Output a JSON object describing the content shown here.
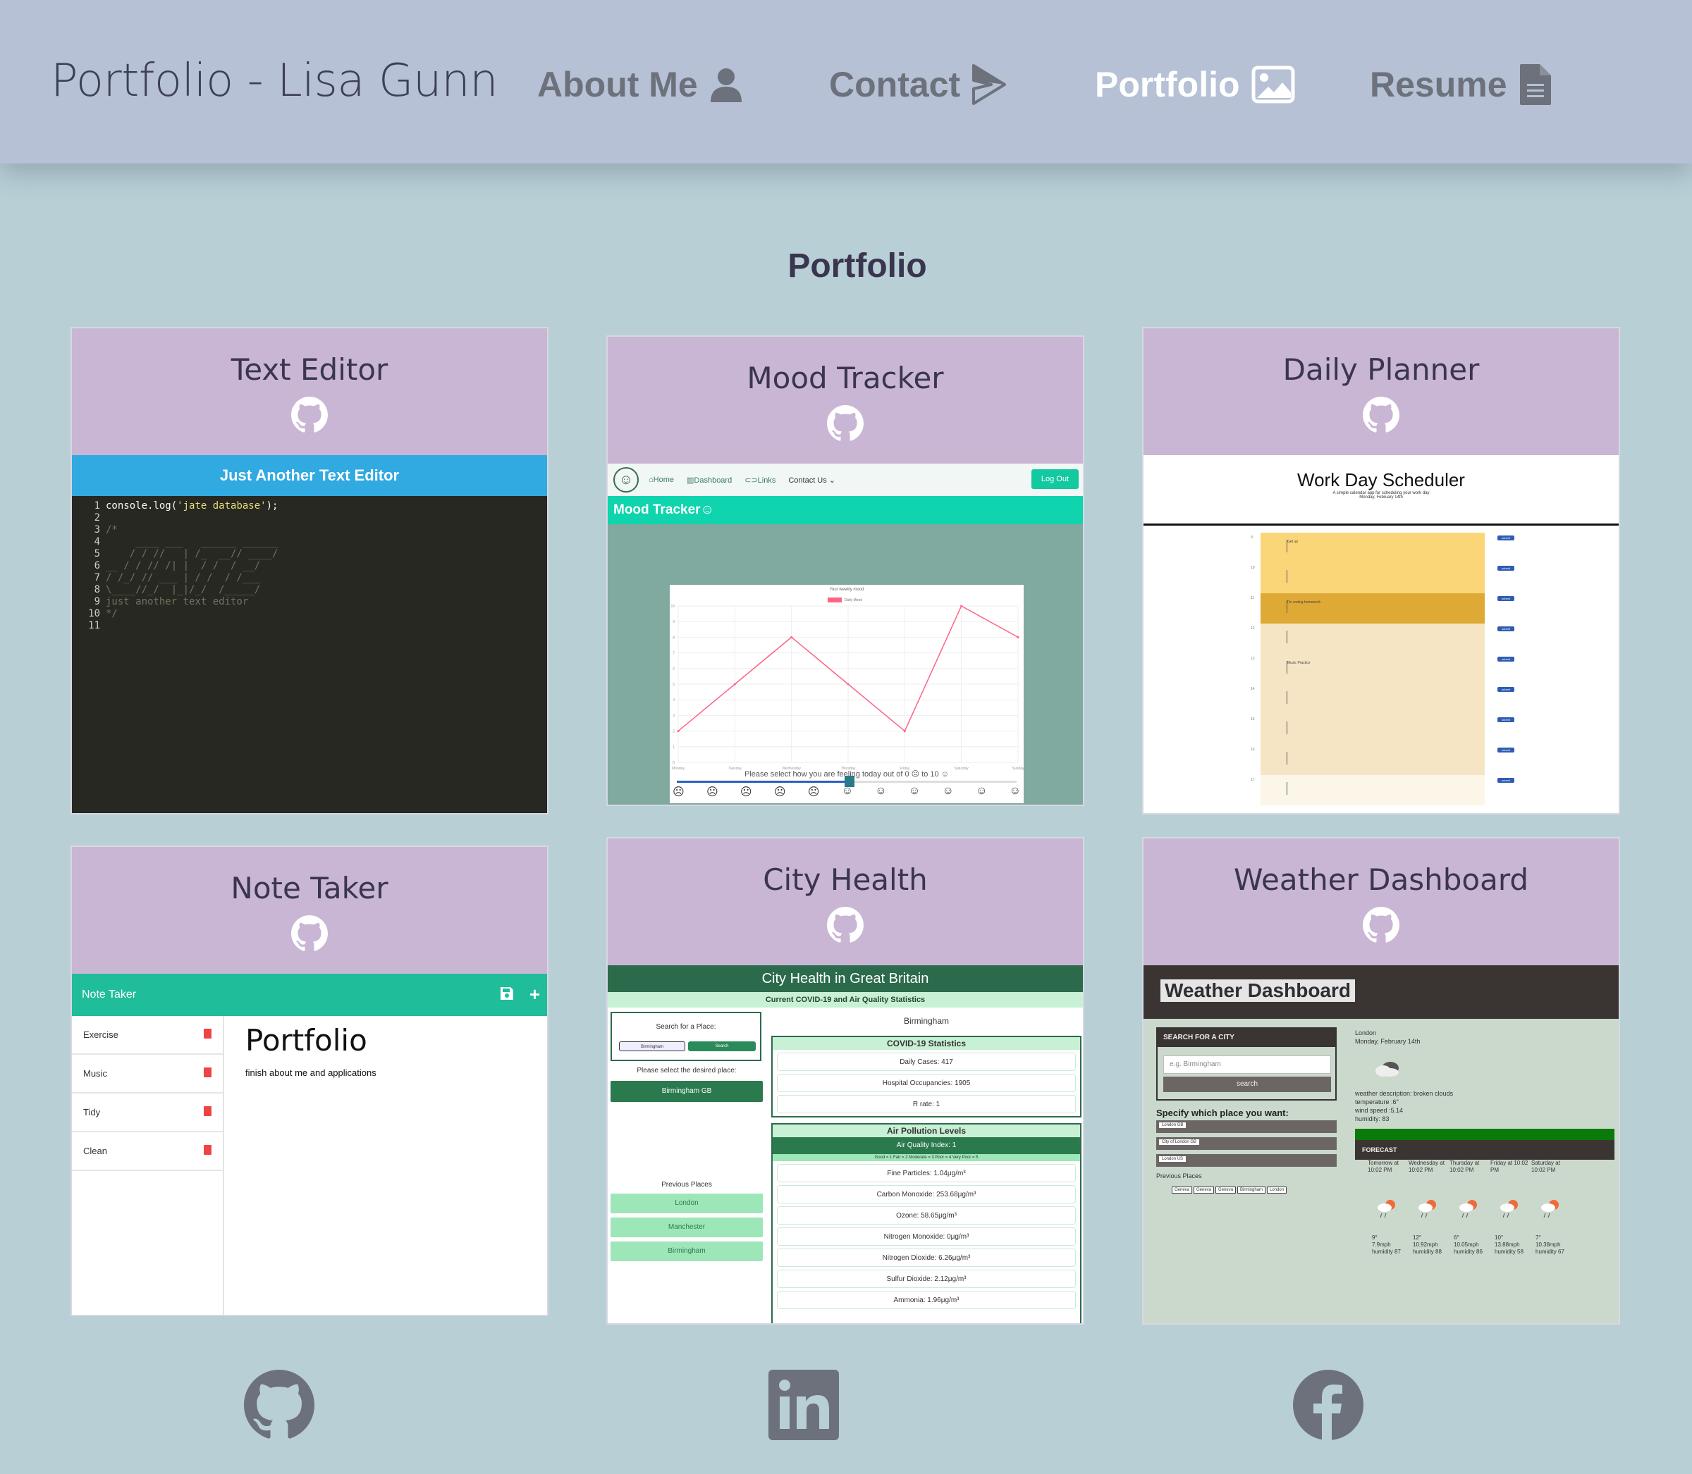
{
  "brand": "Portfolio - Lisa Gunn",
  "nav": {
    "about": {
      "label": "About Me",
      "icon": "person-icon"
    },
    "contact": {
      "label": "Contact",
      "icon": "paper-plane-icon"
    },
    "portfolio": {
      "label": "Portfolio",
      "icon": "image-icon",
      "active": true
    },
    "resume": {
      "label": "Resume",
      "icon": "document-icon"
    }
  },
  "section_title": "Portfolio",
  "projects": [
    {
      "title": "Text Editor",
      "icon": "github-icon"
    },
    {
      "title": "Mood Tracker",
      "icon": "github-icon"
    },
    {
      "title": "Daily Planner",
      "icon": "github-icon"
    },
    {
      "title": "Note Taker",
      "icon": "github-icon"
    },
    {
      "title": "City Health",
      "icon": "github-icon"
    },
    {
      "title": "Weather Dashboard",
      "icon": "github-icon"
    }
  ],
  "text_editor_shot": {
    "header": "Just Another Text Editor",
    "code_line1_pre": "console.log(",
    "code_line1_str": "'jate database'",
    "code_line1_post": ");",
    "art": [
      "/*",
      "",
      "     ____ ___   ______ ______",
      "    / / //   | /_  __// ____/",
      "__ / / // /| |  / /  / __/   ",
      "/ /_/ // ___ | / /  / /___   ",
      "\\____//_/  |_|/_/  /_____/   ",
      "just another text editor",
      "*/"
    ]
  },
  "mood_tracker_shot": {
    "nav_links": [
      "⌂Home",
      "▥Dashboard",
      "⊂⊃Links",
      "Contact Us ⌄"
    ],
    "logout": "Log Out",
    "header": "Mood Tracker☺",
    "chart_title": "Your weekly mood",
    "legend": "Daily Mood",
    "prompt": "Please select how you are feeling today out of 0 ☹ to 10 ☺",
    "faces": [
      "☹",
      "☹",
      "☹",
      "☹",
      "☹",
      "☺",
      "☺",
      "☺",
      "☺",
      "☺",
      "☺"
    ]
  },
  "chart_data": {
    "type": "line",
    "title": "Your weekly mood",
    "categories": [
      "Monday",
      "Tuesday",
      "Wednesday",
      "Thursday",
      "Friday",
      "Saturday",
      "Sunday"
    ],
    "series": [
      {
        "name": "Daily Mood",
        "values": [
          2,
          5,
          8,
          5,
          2,
          10,
          8
        ]
      }
    ],
    "ylim": [
      0,
      10
    ],
    "yticks": [
      0,
      1,
      2,
      3,
      4,
      5,
      6,
      7,
      8,
      9,
      10
    ],
    "grid": true,
    "legend_position": "top-center",
    "color": "#ff6384"
  },
  "daily_planner_shot": {
    "title": "Work Day Scheduler",
    "subtitle": "A simple calendar app for scheduling your work day",
    "date": "Monday, February 14th",
    "hours": [
      {
        "hour": "9",
        "desc": "Get up",
        "color": "#fbd679"
      },
      {
        "hour": "10",
        "desc": "",
        "color": "#fbd679"
      },
      {
        "hour": "11",
        "desc": "Do coding homework",
        "color": "#dfa935"
      },
      {
        "hour": "12",
        "desc": "",
        "color": "#f5e5c5"
      },
      {
        "hour": "13",
        "desc": "Music Practice",
        "color": "#f5e5c5"
      },
      {
        "hour": "14",
        "desc": "",
        "color": "#f5e5c5"
      },
      {
        "hour": "15",
        "desc": "",
        "color": "#f5e5c5"
      },
      {
        "hour": "16",
        "desc": "",
        "color": "#f5e5c5"
      },
      {
        "hour": "17",
        "desc": "",
        "color": "#fcf6e8"
      }
    ],
    "button_label": "submit"
  },
  "note_taker_shot": {
    "header": "Note Taker",
    "notes": [
      "Exercise",
      "Music",
      "Tidy",
      "Clean"
    ],
    "active_title": "Portfolio",
    "active_text": "finish about me and applications"
  },
  "city_health_shot": {
    "header": "City Health in Great Britain",
    "subheader": "Current COVID-19 and Air Quality Statistics",
    "search_label": "Search for a Place:",
    "search_placeholder": "Birmingham",
    "search_button": "Search",
    "select_label": "Please select the desired place:",
    "selected_place": "Birmingham GB",
    "previous_label": "Previous Places",
    "previous_places": [
      "London",
      "Manchester",
      "Birmingham"
    ],
    "place_title": "Birmingham",
    "covid_title": "COVID-19 Statistics",
    "covid_stats": [
      "Daily Cases: 417",
      "Hospital Occupancies: 1905",
      "R rate: 1"
    ],
    "air_title": "Air Pollution Levels",
    "aqi": "Air Quality Index: 1",
    "aqi_scale": "Good = 1 Fair = 2 Moderate = 3 Poor = 4 Very Poor = 5",
    "pollutants": [
      "Fine Particles: 1.04μg/m³",
      "Carbon Monoxide: 253.68μg/m³",
      "Ozone: 58.65μg/m³",
      "Nitrogen Monoxide: 0μg/m³",
      "Nitrogen Dioxide: 6.26μg/m³",
      "Sulfur Dioxide: 2.12μg/m³",
      "Ammonia: 1.96μg/m³"
    ]
  },
  "weather_shot": {
    "title": "Weather Dashboard",
    "search_heading": "SEARCH FOR A CITY",
    "search_placeholder": "e.g. Birmingham",
    "search_button": "search",
    "specify_label": "Specify which place you want:",
    "options": [
      "London GB",
      "City of London GB",
      "London US"
    ],
    "previous_label": "Previous Places",
    "previous_places": [
      "Geneva",
      "Geneva",
      "Geneva",
      "Birmingham",
      "London"
    ],
    "city": "London",
    "date": "Monday, February 14th",
    "current": [
      "weather description: broken clouds",
      "temperature :6°",
      "wind speed :5.14",
      "humidity: 83"
    ],
    "forecast_heading": "FORECAST",
    "forecast": [
      {
        "day": "Tomorrow at 10:02 PM",
        "temp": "9°",
        "wind": "7.9mph",
        "humidity": "humidity 87"
      },
      {
        "day": "Wednesday at 10:02 PM",
        "temp": "12°",
        "wind": "10.92mph",
        "humidity": "humidity 88"
      },
      {
        "day": "Thursday at 10:02 PM",
        "temp": "6°",
        "wind": "10.05mph",
        "humidity": "humidity 86"
      },
      {
        "day": "Friday at 10:02 PM",
        "temp": "10°",
        "wind": "13.88mph",
        "humidity": "humidity 58"
      },
      {
        "day": "Saturday at 10:02 PM",
        "temp": "7°",
        "wind": "10.38mph",
        "humidity": "humidity 67"
      }
    ]
  },
  "footer": {
    "icons": [
      "github-icon",
      "linkedin-icon",
      "facebook-icon"
    ],
    "icon_color": "#6c717b"
  }
}
